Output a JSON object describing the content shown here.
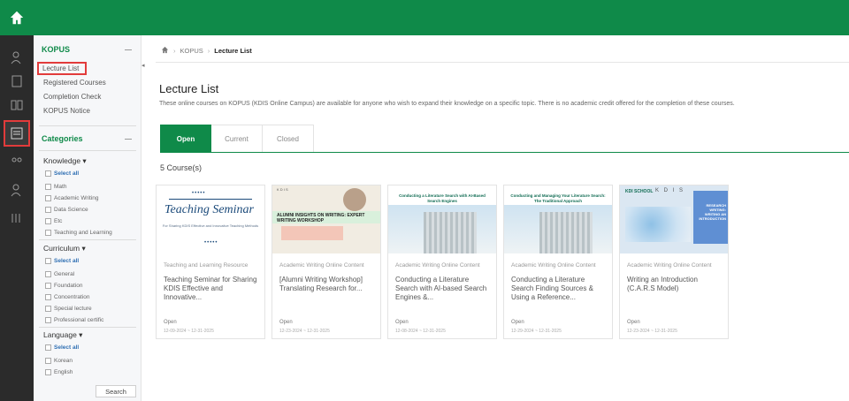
{
  "sidebar": {
    "section_title": "KOPUS",
    "links": [
      "Lecture List",
      "Registered Courses",
      "Completion Check",
      "KOPUS Notice"
    ],
    "categories_title": "Categories",
    "groups": [
      {
        "title": "Knowledge ▾",
        "select_all": "Select all",
        "items": [
          "Math",
          "Academic Writing",
          "Data Science",
          "Etc",
          "Teaching and Learning"
        ]
      },
      {
        "title": "Curriculum ▾",
        "select_all": "Select all",
        "items": [
          "General",
          "Foundation",
          "Concentration",
          "Special lecture",
          "Professional certific"
        ]
      },
      {
        "title": "Language ▾",
        "select_all": "Select all",
        "items": [
          "Korean",
          "English"
        ]
      }
    ],
    "search_button": "Search"
  },
  "breadcrumb": {
    "section": "KOPUS",
    "current": "Lecture List"
  },
  "page": {
    "title": "Lecture List",
    "description": "These online courses on KOPUS (KDIS Online Campus) are available for anyone who wish to expand their knowledge on a specific topic. There is no academic credit offered for the completion of these courses.",
    "tabs": [
      "Open",
      "Current",
      "Closed"
    ],
    "active_tab": "Open",
    "count": "5 Course(s)"
  },
  "cards": [
    {
      "category": "Teaching and Learning Resource",
      "title": "Teaching Seminar for Sharing KDIS Effective and Innovative...",
      "status": "Open",
      "date": "12-09-2024 ~ 12-31-2025",
      "thumb_title": "Teaching Seminar",
      "thumb_sub": "For Sharing KDIS Effective and Innovative Teaching Methods"
    },
    {
      "category": "Academic Writing Online Content",
      "title": "[Alumni Writing Workshop] Translating Research for...",
      "status": "Open",
      "date": "12-23-2024 ~ 12-31-2025",
      "thumb_title": "ALUMNI INSIGHTS ON WRITING: EXPERT WRITING WORKSHOP"
    },
    {
      "category": "Academic Writing Online Content",
      "title": "Conducting a Literature Search with AI-based Search Engines &...",
      "status": "Open",
      "date": "12-08-2024 ~ 12-31-2025",
      "thumb_title": "Conducting a Literature Search with AI-Based Search Engines"
    },
    {
      "category": "Academic Writing Online Content",
      "title": "Conducting a Literature Search Finding Sources & Using a Reference...",
      "status": "Open",
      "date": "12-29-2024 ~ 12-31-2025",
      "thumb_title": "Conducting and Managing Your Literature Search: The Traditional Approach"
    },
    {
      "category": "Academic Writing Online Content",
      "title": "Writing an Introduction (C.A.R.S Model)",
      "status": "Open",
      "date": "12-23-2024 ~ 12-31-2025",
      "thumb_title": "RESEARCH WRITING: WRITING AN INTRODUCTION",
      "thumb_logo": "KDI SCHOOL",
      "thumb_kdis": "K D I S"
    }
  ]
}
